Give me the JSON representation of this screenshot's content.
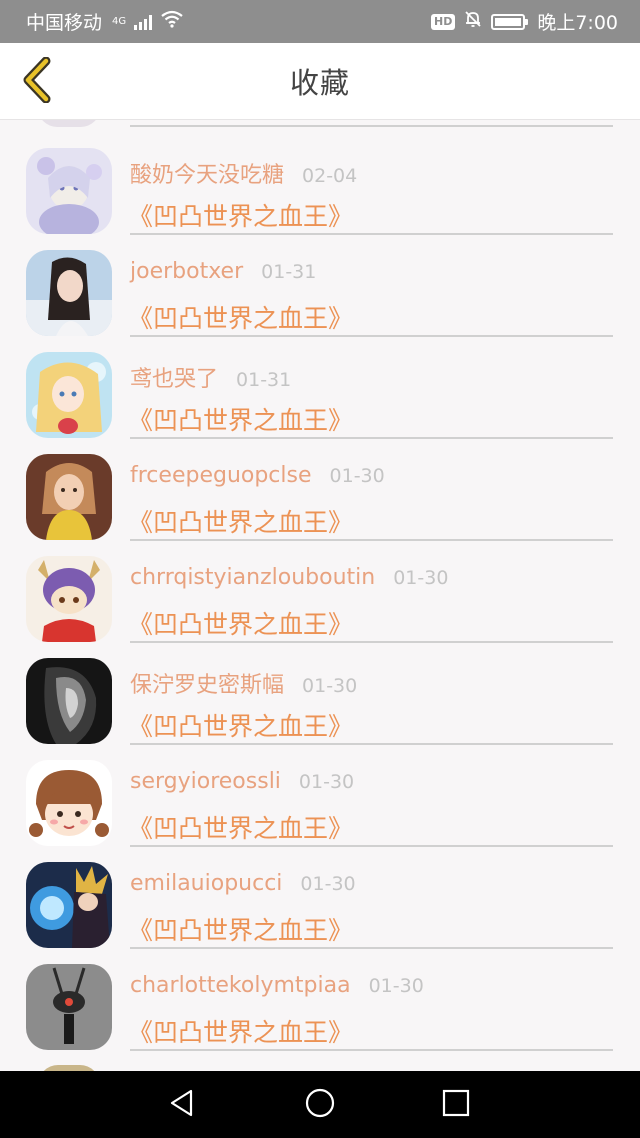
{
  "status_bar": {
    "carrier": "中国移动",
    "network": "4G",
    "hd": "HD",
    "time": "晚上7:00",
    "icons": [
      "signal-icon",
      "wifi-icon",
      "hd-icon",
      "mute-bell-icon",
      "battery-icon"
    ]
  },
  "header": {
    "title": "收藏",
    "back_icon": "chevron-left-icon",
    "accent": "#e8c22a"
  },
  "colors": {
    "username": "#e8a27f",
    "book_title": "#ec9254",
    "date": "#c4c4c4"
  },
  "items": [
    {
      "username": "酸奶今天没吃糖",
      "date": "02-04",
      "book": "《凹凸世界之血王》"
    },
    {
      "username": "joerbotxer",
      "date": "01-31",
      "book": "《凹凸世界之血王》"
    },
    {
      "username": "鸢也哭了",
      "date": "01-31",
      "book": "《凹凸世界之血王》"
    },
    {
      "username": "frceepeguopclse",
      "date": "01-30",
      "book": "《凹凸世界之血王》"
    },
    {
      "username": "chrrqistyianzlouboutin",
      "date": "01-30",
      "book": "《凹凸世界之血王》"
    },
    {
      "username": "保泞罗史密斯幅",
      "date": "01-30",
      "book": "《凹凸世界之血王》"
    },
    {
      "username": "sergyioreossli",
      "date": "01-30",
      "book": "《凹凸世界之血王》"
    },
    {
      "username": "emilauiopucci",
      "date": "01-30",
      "book": "《凹凸世界之血王》"
    },
    {
      "username": "charlottekolymtpiaa",
      "date": "01-30",
      "book": "《凹凸世界之血王》"
    }
  ],
  "nav_bar": {
    "icons": [
      "back-triangle-icon",
      "home-circle-icon",
      "recents-square-icon"
    ]
  }
}
